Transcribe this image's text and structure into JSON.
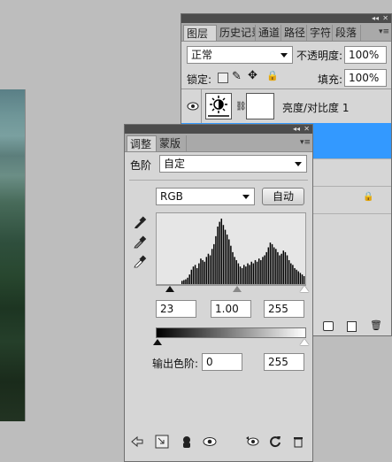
{
  "layers_panel": {
    "tabs": [
      "图层",
      "历史记录",
      "通道",
      "路径",
      "字符",
      "段落"
    ],
    "blend_mode": "正常",
    "opacity_label": "不透明度:",
    "opacity_value": "100%",
    "lock_label": "锁定:",
    "fill_label": "填充:",
    "fill_value": "100%",
    "layer_name": "亮度/对比度 1"
  },
  "adjustments_panel": {
    "tabs": [
      "调整",
      "蒙版"
    ],
    "preset_label": "色阶",
    "preset_value": "自定",
    "channel_value": "RGB",
    "auto_button": "自动",
    "input_black": "23",
    "input_gamma": "1.00",
    "input_white": "255",
    "output_label": "输出色阶:",
    "output_black": "0",
    "output_white": "255"
  },
  "histogram": [
    4,
    5,
    6,
    8,
    12,
    18,
    22,
    24,
    20,
    26,
    32,
    30,
    28,
    34,
    38,
    36,
    44,
    50,
    60,
    72,
    78,
    82,
    74,
    68,
    62,
    56,
    48,
    40,
    34,
    30,
    26,
    22,
    20,
    24,
    22,
    26,
    24,
    28,
    26,
    30,
    28,
    32,
    30,
    34,
    36,
    40,
    46,
    52,
    50,
    46,
    44,
    40,
    36,
    38,
    42,
    40,
    36,
    30,
    26,
    24,
    20,
    18,
    16,
    14,
    12,
    10
  ],
  "colors": {
    "panel_bg": "#d6d6d6",
    "selected_layer": "#3399ff",
    "titlebar": "#4c4c4c"
  }
}
